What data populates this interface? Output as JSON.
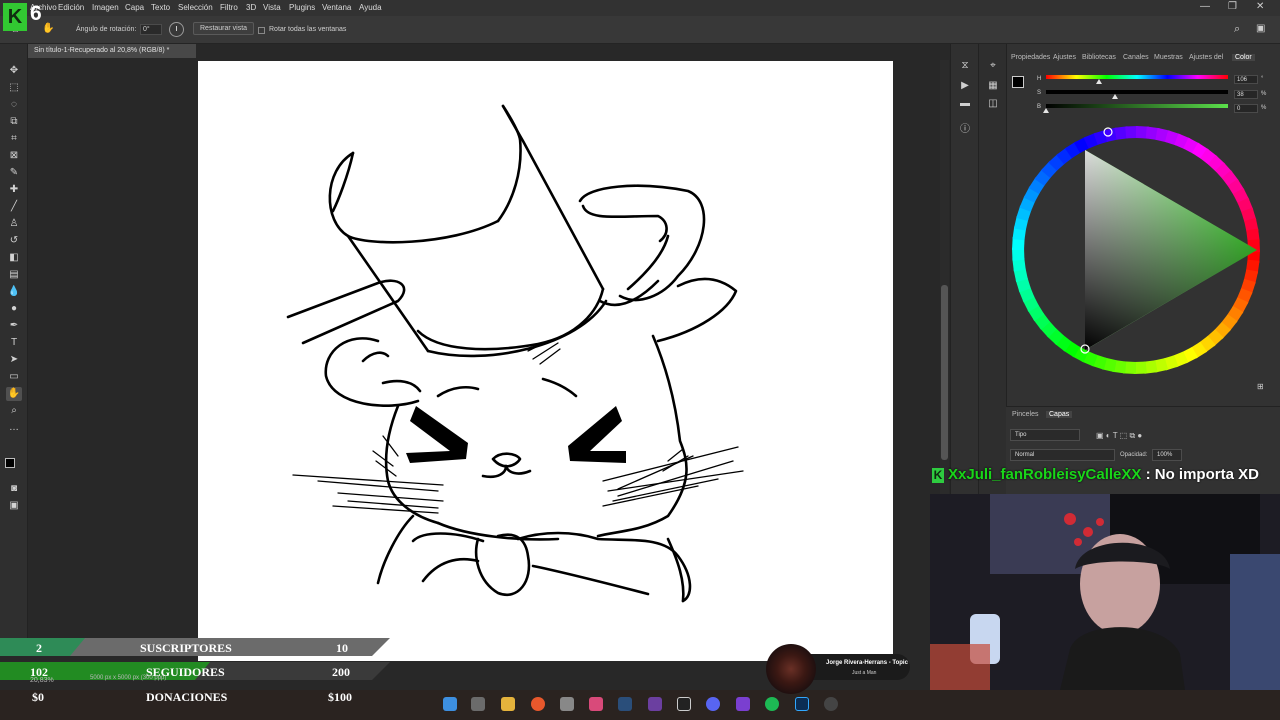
{
  "logo": {
    "letter": "K",
    "number": "6"
  },
  "menubar": {
    "items": [
      "Archivo",
      "Edición",
      "Imagen",
      "Capa",
      "Texto",
      "Selección",
      "Filtro",
      "3D",
      "Vista",
      "Plugins",
      "Ventana",
      "Ayuda"
    ]
  },
  "options": {
    "rotation_label": "Ángulo de rotación:",
    "rotation_value": "0°",
    "reset_view": "Restaurar vista",
    "rotate_all": "Rotar todas las ventanas"
  },
  "document": {
    "tab_title": "Sin título-1-Recuperado al 20,8% (RGB/8) *"
  },
  "color_panel": {
    "tabs": [
      "Propiedades",
      "Ajustes",
      "Bibliotecas",
      "Canales",
      "Muestras",
      "Ajustes del",
      "Color"
    ],
    "active_tab": "Color",
    "h_label": "H",
    "h_value": "106",
    "h_unit": "°",
    "s_label": "S",
    "s_value": "38",
    "s_unit": "%",
    "b_label": "B",
    "b_value": "0",
    "b_unit": "%",
    "h_fraction": 0.29,
    "s_fraction": 0.38,
    "b_fraction": 0.0,
    "wheel_hue_color": "#3bd12b"
  },
  "layers_panel": {
    "tabs": [
      "Pinceles",
      "Capas"
    ],
    "active_tab": "Capas",
    "filter_kind": "Tipo",
    "blend_mode": "Normal",
    "opacity_label": "Opacidad:",
    "opacity_value": "100%"
  },
  "chat": {
    "username": "XxJuli_fanRobleisyCalleXX",
    "separator": ":",
    "message": "No importa XD"
  },
  "stats": {
    "subs": {
      "current": "2",
      "label": "SUSCRIPTORES",
      "goal": "10",
      "color": "#2e8b57"
    },
    "followers": {
      "current": "102",
      "label": "SEGUIDORES",
      "goal": "200",
      "color": "#228b22"
    },
    "donations": {
      "current": "$0",
      "label": "DONACIONES",
      "goal": "$100"
    }
  },
  "statusbar": {
    "zoom": "20,83%",
    "doc_size": "5000 px x 5000 px (300 ppp)"
  },
  "now_playing": {
    "title": "Jorge Rivera-Herrans - Topic",
    "artist": "Just a Man"
  }
}
